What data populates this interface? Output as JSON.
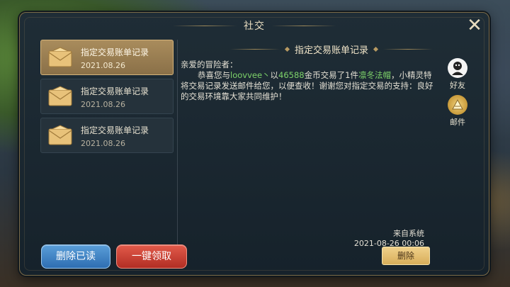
{
  "window": {
    "title": "社交"
  },
  "mail_list": [
    {
      "title": "指定交易账单记录",
      "date": "2021.08.26",
      "active": true
    },
    {
      "title": "指定交易账单记录",
      "date": "2021.08.26",
      "active": false
    },
    {
      "title": "指定交易账单记录",
      "date": "2021.08.26",
      "active": false
    }
  ],
  "mail": {
    "title": "指定交易账单记录",
    "greeting": "亲爱的冒险者：",
    "body_p1": "恭喜您与",
    "buyer": "loovvee丶",
    "body_p2": "以",
    "gold": "46588",
    "body_p3": "金币交易了",
    "qty": "1",
    "body_p4": "件",
    "item": "凛冬法帽",
    "body_p5": "，小精灵特将交易记录发送邮件给您，以便查收！谢谢您对指定交易的支持：良好的交易环境靠大家共同维护！",
    "sender": "来自系统",
    "sent_time": "2021-08-26  00:06",
    "delete_label": "删除"
  },
  "actions": {
    "delete_read": "删除已读",
    "claim_all": "一键领取"
  },
  "side_tabs": {
    "friends": "好友",
    "mail": "邮件"
  },
  "colors": {
    "highlight": "#7ed36a",
    "active_tab": "#a98c5c"
  }
}
